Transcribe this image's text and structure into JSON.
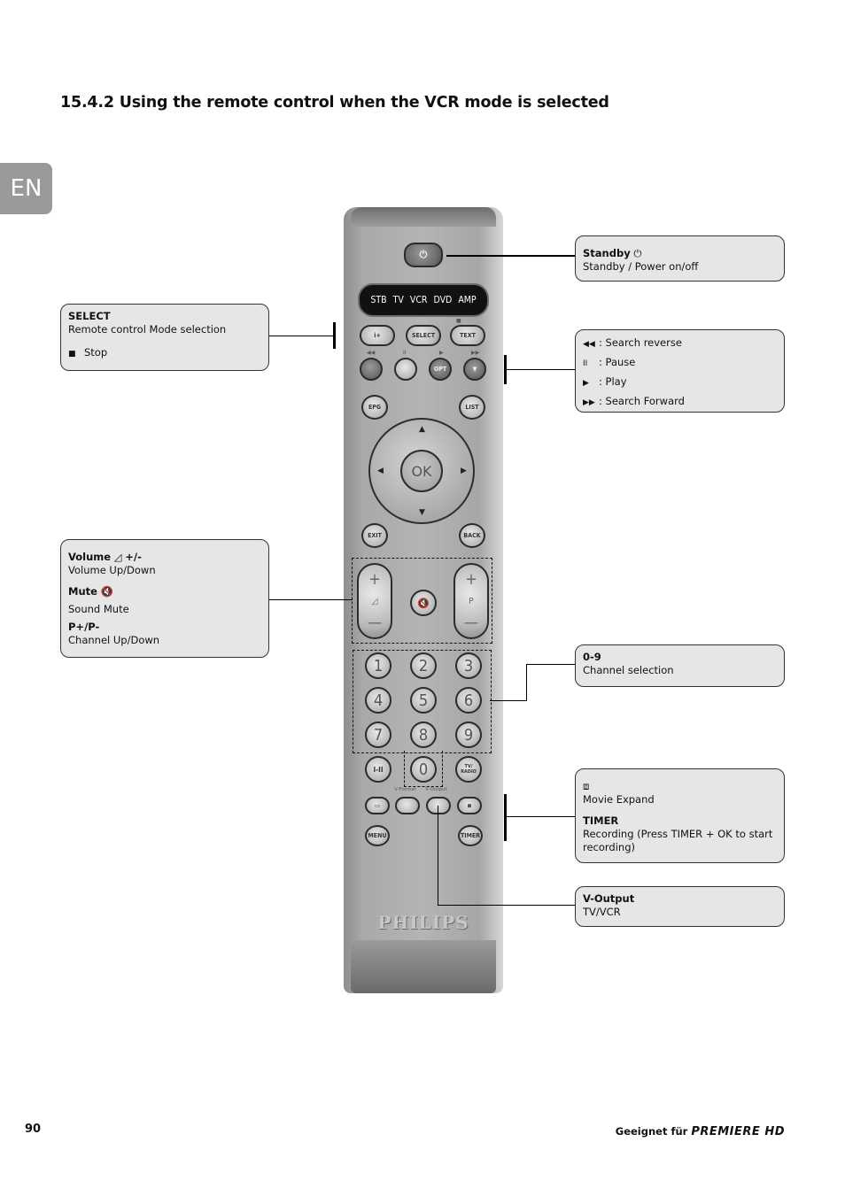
{
  "page": {
    "title": "15.4.2 Using the remote control when the VCR mode is selected",
    "language_tab": "EN",
    "page_number": "90",
    "footer_label": "Geeignet für",
    "footer_brand": "PREMIERE HD"
  },
  "remote": {
    "mode_display": [
      "STB",
      "TV",
      "VCR",
      "DVD",
      "AMP"
    ],
    "buttons": {
      "info": "i+",
      "select": "SELECT",
      "text": "TEXT",
      "opt": "OPT",
      "epg": "EPG",
      "list": "LIST",
      "ok": "OK",
      "exit": "EXIT",
      "back": "BACK",
      "vol_plus": "+",
      "vol_minus": "—",
      "p_plus": "+",
      "p_label": "P",
      "p_minus": "—",
      "numbers": [
        "1",
        "2",
        "3",
        "4",
        "5",
        "6",
        "7",
        "8",
        "9",
        "0"
      ],
      "dual": "I-II",
      "tv_radio": "TV/ RADIO",
      "menu": "MENU",
      "timer": "TIMER"
    },
    "small_labels": {
      "rewind": "◀◀",
      "pause": "II",
      "play": "▶",
      "ffwd": "▶▶",
      "stop": "■",
      "v_format": "V-Format",
      "v_output": "V-Output"
    },
    "brand": "PHILIPS"
  },
  "callouts": {
    "standby": {
      "title": "Standby",
      "icon": "power-icon",
      "desc": "Standby / Power on/off"
    },
    "select": {
      "title": "SELECT",
      "desc": "Remote control Mode selection",
      "stop_label": "Stop"
    },
    "transport": [
      {
        "symbol": "◀◀",
        "label": ": Search reverse"
      },
      {
        "symbol": "II",
        "label": ": Pause"
      },
      {
        "symbol": "▶",
        "label": ": Play"
      },
      {
        "symbol": "▶▶",
        "label": ": Search Forward"
      }
    ],
    "volume": {
      "volume_title": "Volume",
      "volume_suffix": "+/-",
      "volume_desc": "Volume Up/Down",
      "mute_title": "Mute",
      "mute_desc": "Sound Mute",
      "channel_title": "P+/P-",
      "channel_desc": "Channel Up/Down"
    },
    "numbers": {
      "title": "0-9",
      "desc": "Channel selection"
    },
    "movie_timer": {
      "movie_desc": "Movie Expand",
      "timer_title": "TIMER",
      "timer_desc": "Recording (Press TIMER + OK to start recording)"
    },
    "v_output": {
      "title": "V-Output",
      "desc": "TV/VCR"
    }
  }
}
